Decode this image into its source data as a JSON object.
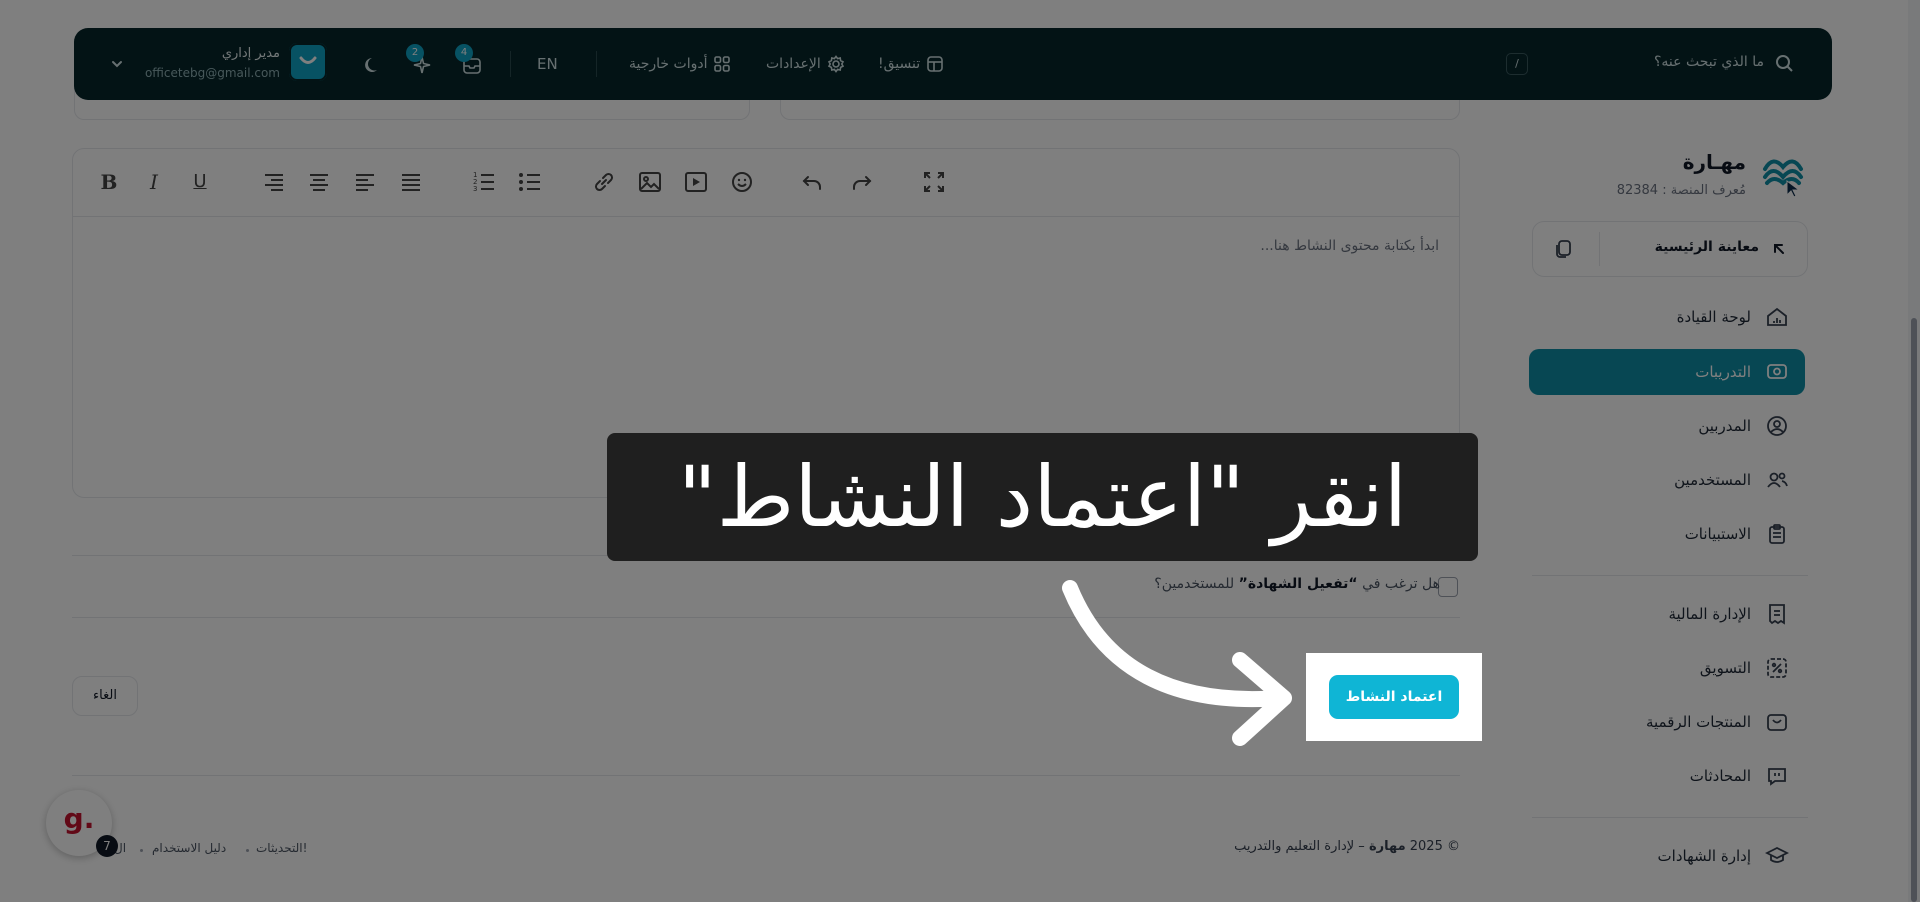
{
  "header": {
    "search_placeholder": "ما الذي تبحث عنه؟",
    "shortcut_key": "/",
    "nav": {
      "format": "تنسيق!",
      "settings": "الإعدادات",
      "external_tools": "أدوات خارجية"
    },
    "language": "EN",
    "notifications_count": "4",
    "updates_count": "2",
    "user": {
      "name": "مدير إداري",
      "email": "officetebg@gmail.com"
    }
  },
  "sidebar": {
    "brand_name": "مهـارة",
    "platform_id": "مُعرف المنصة : 82384",
    "preview_button": "معاينة الرئيسية",
    "items": [
      {
        "label": "لوحة القيادة",
        "icon": "dashboard-icon"
      },
      {
        "label": "التدريبات",
        "icon": "trainings-icon",
        "active": true
      },
      {
        "label": "المدربين",
        "icon": "user-circle-icon"
      },
      {
        "label": "المستخدمين",
        "icon": "users-icon"
      },
      {
        "label": "الاستبيانات",
        "icon": "clipboard-icon"
      }
    ],
    "items2": [
      {
        "label": "الإدارة المالية",
        "icon": "receipt-icon"
      },
      {
        "label": "التسويق",
        "icon": "discount-icon"
      },
      {
        "label": "المنتجات الرقمية",
        "icon": "bag-icon"
      },
      {
        "label": "المحادثات",
        "icon": "chat-icon"
      }
    ],
    "items3": [
      {
        "label": "إدارة الشهادات",
        "icon": "graduation-icon"
      }
    ]
  },
  "editor": {
    "placeholder": "ابدأ بكتابة محتوى النشاط هنا..."
  },
  "certificate": {
    "question_prefix": "هل ترغب في",
    "question_highlight": "“تفعيل الشهادة”",
    "question_suffix": "للمستخدمين؟"
  },
  "actions": {
    "approve": "اعتماد النشاط",
    "cancel": "الغاء"
  },
  "footer": {
    "copyright_prefix": "© 2025",
    "brand": "مهارة",
    "copyright_suffix": "– لإدارة التعليم والتدريب",
    "links": [
      "التحديثات!",
      "دليل الاستخدام",
      "ال"
    ]
  },
  "tutorial": {
    "caption": "انقر \"اعتماد النشاط\""
  },
  "widget": {
    "letter": "g.",
    "count": "7"
  },
  "colors": {
    "header_bg": "#06262b",
    "accent": "#0e8fa6",
    "approve": "#0fb5d5"
  }
}
